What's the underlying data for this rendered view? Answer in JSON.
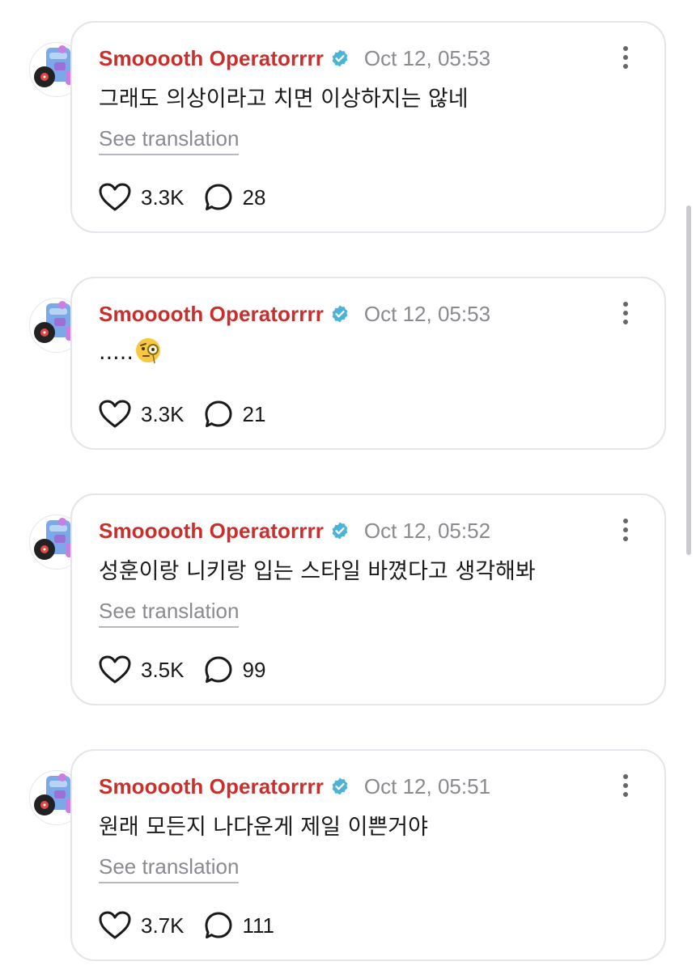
{
  "posts": [
    {
      "username": "Smooooth Operatorrrr",
      "timestamp": "Oct 12, 05:53",
      "text": "그래도 의상이라고 치면 이상하지는 않네",
      "has_emoji": false,
      "see_translation": "See translation",
      "likes": "3.3K",
      "replies": "28"
    },
    {
      "username": "Smooooth Operatorrrr",
      "timestamp": "Oct 12, 05:53",
      "text": ".....",
      "emoji": "face-with-monocle",
      "see_translation": "",
      "likes": "3.3K",
      "replies": "21"
    },
    {
      "username": "Smooooth Operatorrrr",
      "timestamp": "Oct 12, 05:52",
      "text": "성훈이랑 니키랑 입는 스타일 바꼈다고 생각해봐",
      "see_translation": "See translation",
      "likes": "3.5K",
      "replies": "99"
    },
    {
      "username": "Smooooth Operatorrrr",
      "timestamp": "Oct 12, 05:51",
      "text": "원래 모든지 나다운게 제일 이쁜거야",
      "see_translation": "See translation",
      "likes": "3.7K",
      "replies": "111"
    }
  ],
  "colors": {
    "username": "#c8302e",
    "verified_badge": "#4ab3d8",
    "muted_text": "#8a8a90",
    "card_border": "#e4e4ea"
  },
  "icons": {
    "verified": "verified-badge-icon",
    "more": "more-vertical-icon",
    "like": "heart-icon",
    "reply": "speech-bubble-icon"
  }
}
